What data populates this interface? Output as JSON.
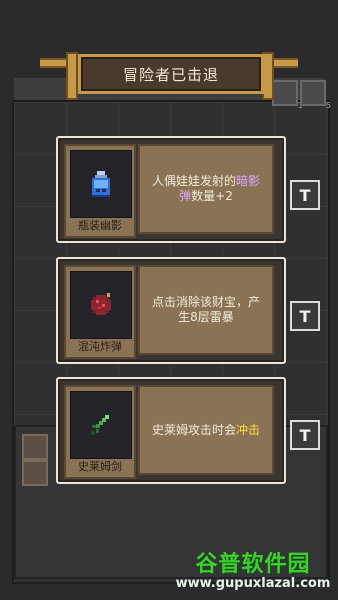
{
  "title": "冒险者已击退",
  "background": {
    "top_slot_counts": [
      "1",
      "5"
    ]
  },
  "cards": [
    {
      "name": "瓶装幽影",
      "icon": "bottled-ghost-icon",
      "desc_parts": [
        "人偶娃娃发射的",
        "暗影弹",
        "数量+2"
      ],
      "highlight_color": "#d9a8ff"
    },
    {
      "name": "混沌炸弹",
      "icon": "chaos-bomb-icon",
      "desc_parts": [
        "点击消除该财宝，产生8层雷暴",
        "",
        ""
      ],
      "highlight_color": ""
    },
    {
      "name": "史莱姆剑",
      "icon": "slime-sword-icon",
      "desc_parts": [
        "史莱姆攻击时会",
        "冲击",
        ""
      ],
      "highlight_color": "#ffe23a"
    }
  ],
  "side_buttons": [
    "T",
    "T",
    "T"
  ],
  "watermark": {
    "main": "谷普软件园",
    "sub": "www.gupuxlazal.com"
  }
}
